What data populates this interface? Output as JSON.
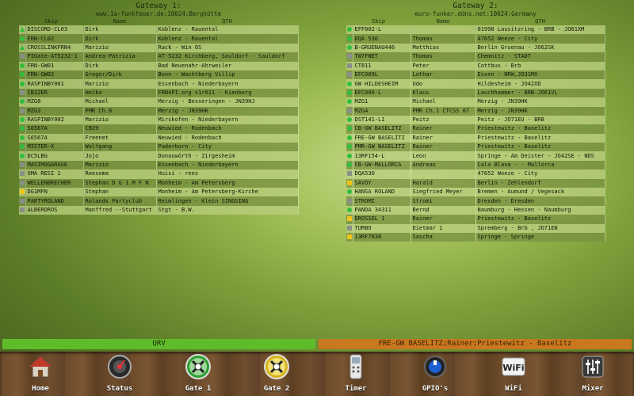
{
  "gateway1": {
    "title": "Gateway 1:",
    "host": "www.1a-funkfeuer.de:10024:Berghütte",
    "headers": [
      "Skip",
      "Name",
      "QTH"
    ],
    "rows": [
      {
        "status": "tri",
        "skip": "DISCORD-CL03",
        "name": "Dirk",
        "qth": "Koblenz - Rauental"
      },
      {
        "status": "green",
        "skip": "FRN-CL02",
        "name": "Dirk",
        "qth": "Koblenz - Rauental"
      },
      {
        "status": "tri",
        "skip": "CROSSLINKFRN4",
        "name": "Marizio",
        "qth": "Rack - Win OS"
      },
      {
        "status": "grey",
        "skip": "PIGate-AT5232-1",
        "name": "Andrea-Patrizia",
        "qth": "AT-5232 Kirchberg, Sauldorf - Sauldorf"
      },
      {
        "status": "green",
        "skip": "FRN-GW01",
        "name": "Dirk",
        "qth": "Bad Neuenahr-Ahrweiler"
      },
      {
        "status": "green",
        "skip": "FRN-GW02",
        "name": "Gregor/Dirk",
        "qth": "Bonn - Wachtberg Villip"
      },
      {
        "status": "green",
        "skip": "RASPINBY001",
        "name": "Marizio",
        "qth": "Essenbach - Niederbayern"
      },
      {
        "status": "grey",
        "skip": "CB12ER",
        "name": "Heiko",
        "qth": "FRN4PI.org v1r011 - Kienberg"
      },
      {
        "status": "green",
        "skip": "MZG8",
        "name": "Michael",
        "qth": "Merzig - Besseringen - JN39HJ"
      },
      {
        "status": "grey",
        "skip": "MZG3",
        "name": "PMR Ch.8",
        "qth": "Merzig - JN39HK"
      },
      {
        "status": "green",
        "skip": "RASPINBY002",
        "name": "Marizio",
        "qth": "Mirskofen - Niederbayern"
      },
      {
        "status": "green",
        "skip": "S6567A",
        "name": "CB29",
        "qth": "Neuwied - Rodenbach"
      },
      {
        "status": "green",
        "skip": "S6567A",
        "name": "Freenet",
        "qth": "Neuwied - Rodenbach"
      },
      {
        "status": "green",
        "skip": "MISTER-X",
        "name": "Wolfgang",
        "qth": "Paderborn - City"
      },
      {
        "status": "green",
        "skip": "DC5LBG",
        "name": "Jojo",
        "qth": "Donauwörth - Zirgesheim"
      },
      {
        "status": "grey",
        "skip": "MASIMOGARAGE",
        "name": "Marizio",
        "qth": "Essenbach - Niederbayern"
      },
      {
        "status": "grey",
        "skip": "OMA RESI 1",
        "name": "Reesoma",
        "qth": "Huisi - rees"
      },
      {
        "status": "grey",
        "skip": "WELLENBRECHER",
        "name": "Stephan D G 1 M F N",
        "qth": "Monheim - Am Petersberg"
      },
      {
        "status": "yellow",
        "skip": "DG1MFN",
        "name": "Stephan",
        "qth": "Monheim - Am Petersberg-Kirche"
      },
      {
        "status": "grey",
        "skip": "PARTYROLAND",
        "name": "Rolands Partyclub",
        "qth": "Reimlingen - Klein SINGSING"
      },
      {
        "status": "grey",
        "skip": "ALBERDROS",
        "name": "Manffred --Stuttgart",
        "qth": "Stgt - B.W."
      }
    ]
  },
  "gateway2": {
    "title": "Gateway 2:",
    "host": "euro-funker.ddns.net:10024:Germany",
    "headers": [
      "Skip",
      "Name",
      "QTH"
    ],
    "rows": [
      {
        "status": "green",
        "skip": "EFF002-L",
        "name": "",
        "qth": "01998 Lausitzring - BRB - JO61XM"
      },
      {
        "status": "green",
        "skip": "DQA 530",
        "name": "Thomas",
        "qth": "47652 Weeze - City"
      },
      {
        "status": "green",
        "skip": "B-GRUENAU446",
        "name": "Matthias",
        "qth": "Berlin Gruenau - JO62SK"
      },
      {
        "status": "grey",
        "skip": "TW7FNET",
        "name": "Thomas",
        "qth": "Chemnitz - STADT"
      },
      {
        "status": "grey",
        "skip": "CT811",
        "name": "Peter",
        "qth": "Cottbus - Brb"
      },
      {
        "status": "grey",
        "skip": "EFC009L",
        "name": "Lothar",
        "qth": "Essen - NRW,JO31MX"
      },
      {
        "status": "green",
        "skip": "GW HILDESHEIM",
        "name": "Udo",
        "qth": "Hildesheim - JO42XD"
      },
      {
        "status": "green",
        "skip": "EFC006-L",
        "name": "Klaus",
        "qth": "Lauchhammer - BRB-JO61VL"
      },
      {
        "status": "green",
        "skip": "MZG1",
        "name": "Michael",
        "qth": "Merzig - JN39HK"
      },
      {
        "status": "grey",
        "skip": "MZG4",
        "name": "PMR Ch.1 CTCSS 67",
        "qth": "Merzig - JN39HK"
      },
      {
        "status": "green",
        "skip": "DST141-L1",
        "name": "Peitz",
        "qth": "Peitz - JO71EU - BRB"
      },
      {
        "status": "green",
        "skip": "CB-GW BASELITZ",
        "name": "Rainer",
        "qth": "Priestewitz - Baselitz"
      },
      {
        "status": "green",
        "skip": "FRE-GW BASELITZ",
        "name": "Rainer",
        "qth": "Priestewitz - Baselitz"
      },
      {
        "status": "green",
        "skip": "PMR-GW BASELITZ",
        "name": "Rainer",
        "qth": "Priestewitz - Baselitz"
      },
      {
        "status": "green",
        "skip": "13RF154-L",
        "name": "Leon",
        "qth": "Springe - Am Deister - JO42SE - NDS"
      },
      {
        "status": "green",
        "skip": "CB-GW-MALLORCA",
        "name": "Andreas",
        "qth": "Cala Blava - - Mallorca"
      },
      {
        "status": "grey",
        "skip": "DQA530",
        "name": "",
        "qth": "47652 Weeze - City"
      },
      {
        "status": "yellow",
        "skip": "SAVOY",
        "name": "Harald",
        "qth": "Berlin - Zehlendorf"
      },
      {
        "status": "green",
        "skip": "HANSA ROLAND",
        "name": "Siegfried Meyer",
        "qth": "Bremen - Aumund / Vegesack"
      },
      {
        "status": "grey",
        "skip": "STROMI",
        "name": "Stromi",
        "qth": "Dresden - Dresden"
      },
      {
        "status": "green",
        "skip": "PANDA 34311",
        "name": "Bernd",
        "qth": "Naumburg - Hessen - Naumburg"
      },
      {
        "status": "yellow",
        "skip": "DROSSEL 1",
        "name": "Rainer",
        "qth": "Priestewitz - Baselitz"
      },
      {
        "status": "grey",
        "skip": "TURBO",
        "name": "Dietmar 1",
        "qth": "Spremberg - Brb , JO71EN"
      },
      {
        "status": "yellow",
        "skip": "13RF7838",
        "name": "Sascha",
        "qth": "Springe - Springe"
      }
    ]
  },
  "status_bar": {
    "left": "QRV",
    "right": "FRE-GW BASELITZ;Rainer;Priestewitz - Baselitz",
    "left_color": "#5fbb2a",
    "right_color": "#c8781f"
  },
  "dock": [
    {
      "label": "Home",
      "icon": "home-icon"
    },
    {
      "label": "Status",
      "icon": "status-icon"
    },
    {
      "label": "Gate 1",
      "icon": "gate1-icon"
    },
    {
      "label": "Gate 2",
      "icon": "gate2-icon"
    },
    {
      "label": "Timer",
      "icon": "timer-icon"
    },
    {
      "label": "GPIO's",
      "icon": "gpio-icon"
    },
    {
      "label": "WiFi",
      "icon": "wifi-icon"
    },
    {
      "label": "Mixer",
      "icon": "mixer-icon"
    }
  ]
}
